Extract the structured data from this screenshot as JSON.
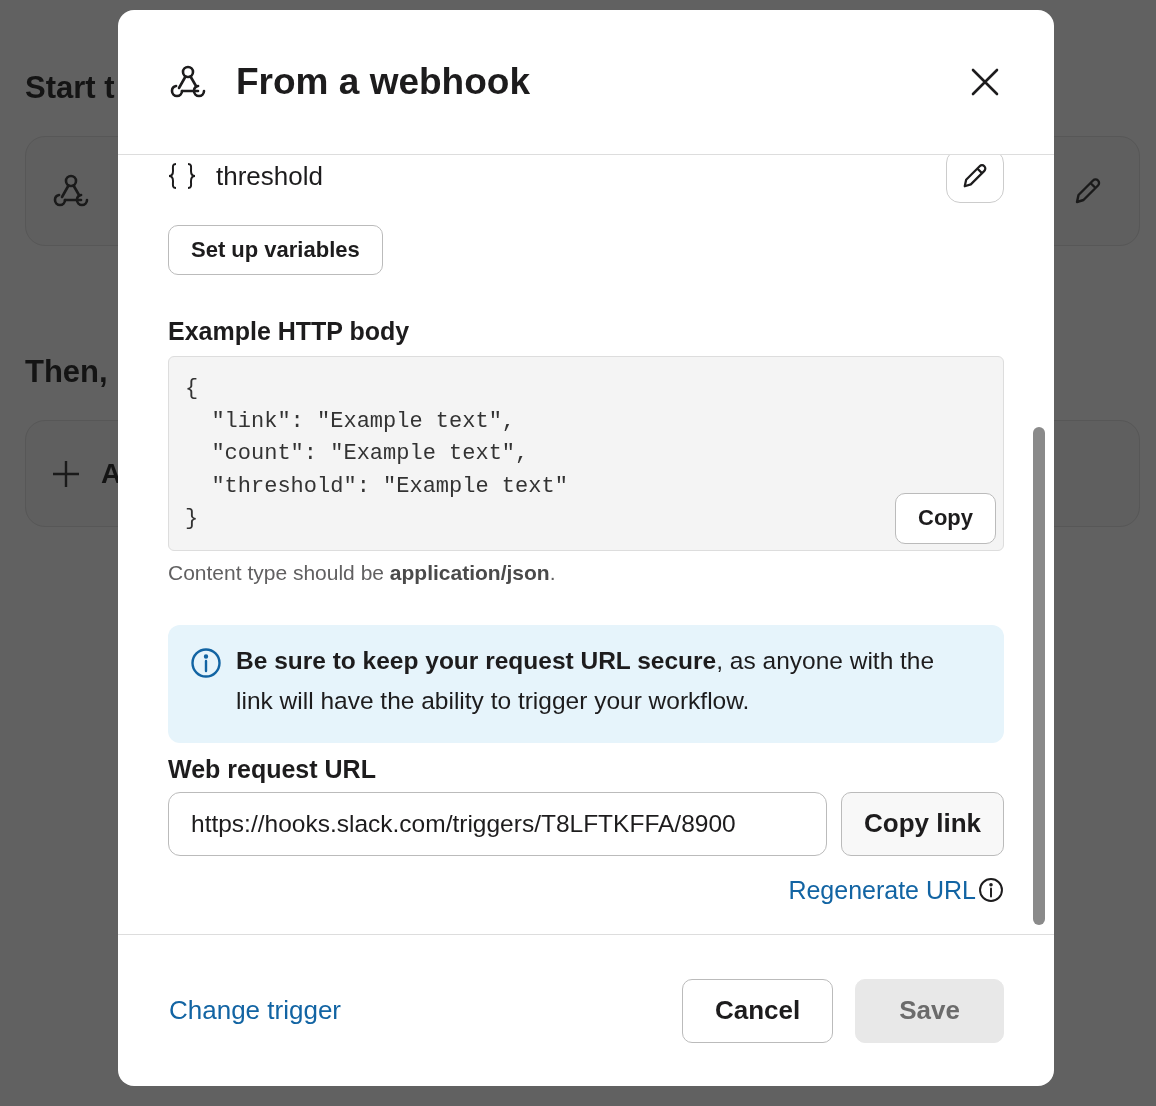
{
  "background": {
    "trigger_heading": "Start t",
    "steps_heading": "Then,",
    "add_label": "A"
  },
  "modal": {
    "title": "From a webhook",
    "variables": [
      {
        "name": "threshold"
      }
    ],
    "setup_button": "Set up variables",
    "example_label": "Example HTTP body",
    "code_lines": [
      "{",
      "  \"link\": \"Example text\",",
      "  \"count\": \"Example text\",",
      "  \"threshold\": \"Example text\"",
      "}"
    ],
    "copy_button": "Copy",
    "hint": "Content type should be **application/json**.",
    "notice": "**Be sure to keep your request URL secure**, as anyone with the link will have the ability to trigger your workflow.",
    "url_label": "Web request URL",
    "url_value": "https://hooks.slack.com/triggers/T8LFTKFFA/8900",
    "copy_link_button": "Copy link",
    "regenerate_link": "Regenerate URL",
    "change_trigger_link": "Change trigger",
    "cancel_button": "Cancel",
    "save_button": {
      "label": "Save",
      "disabled": true
    }
  }
}
